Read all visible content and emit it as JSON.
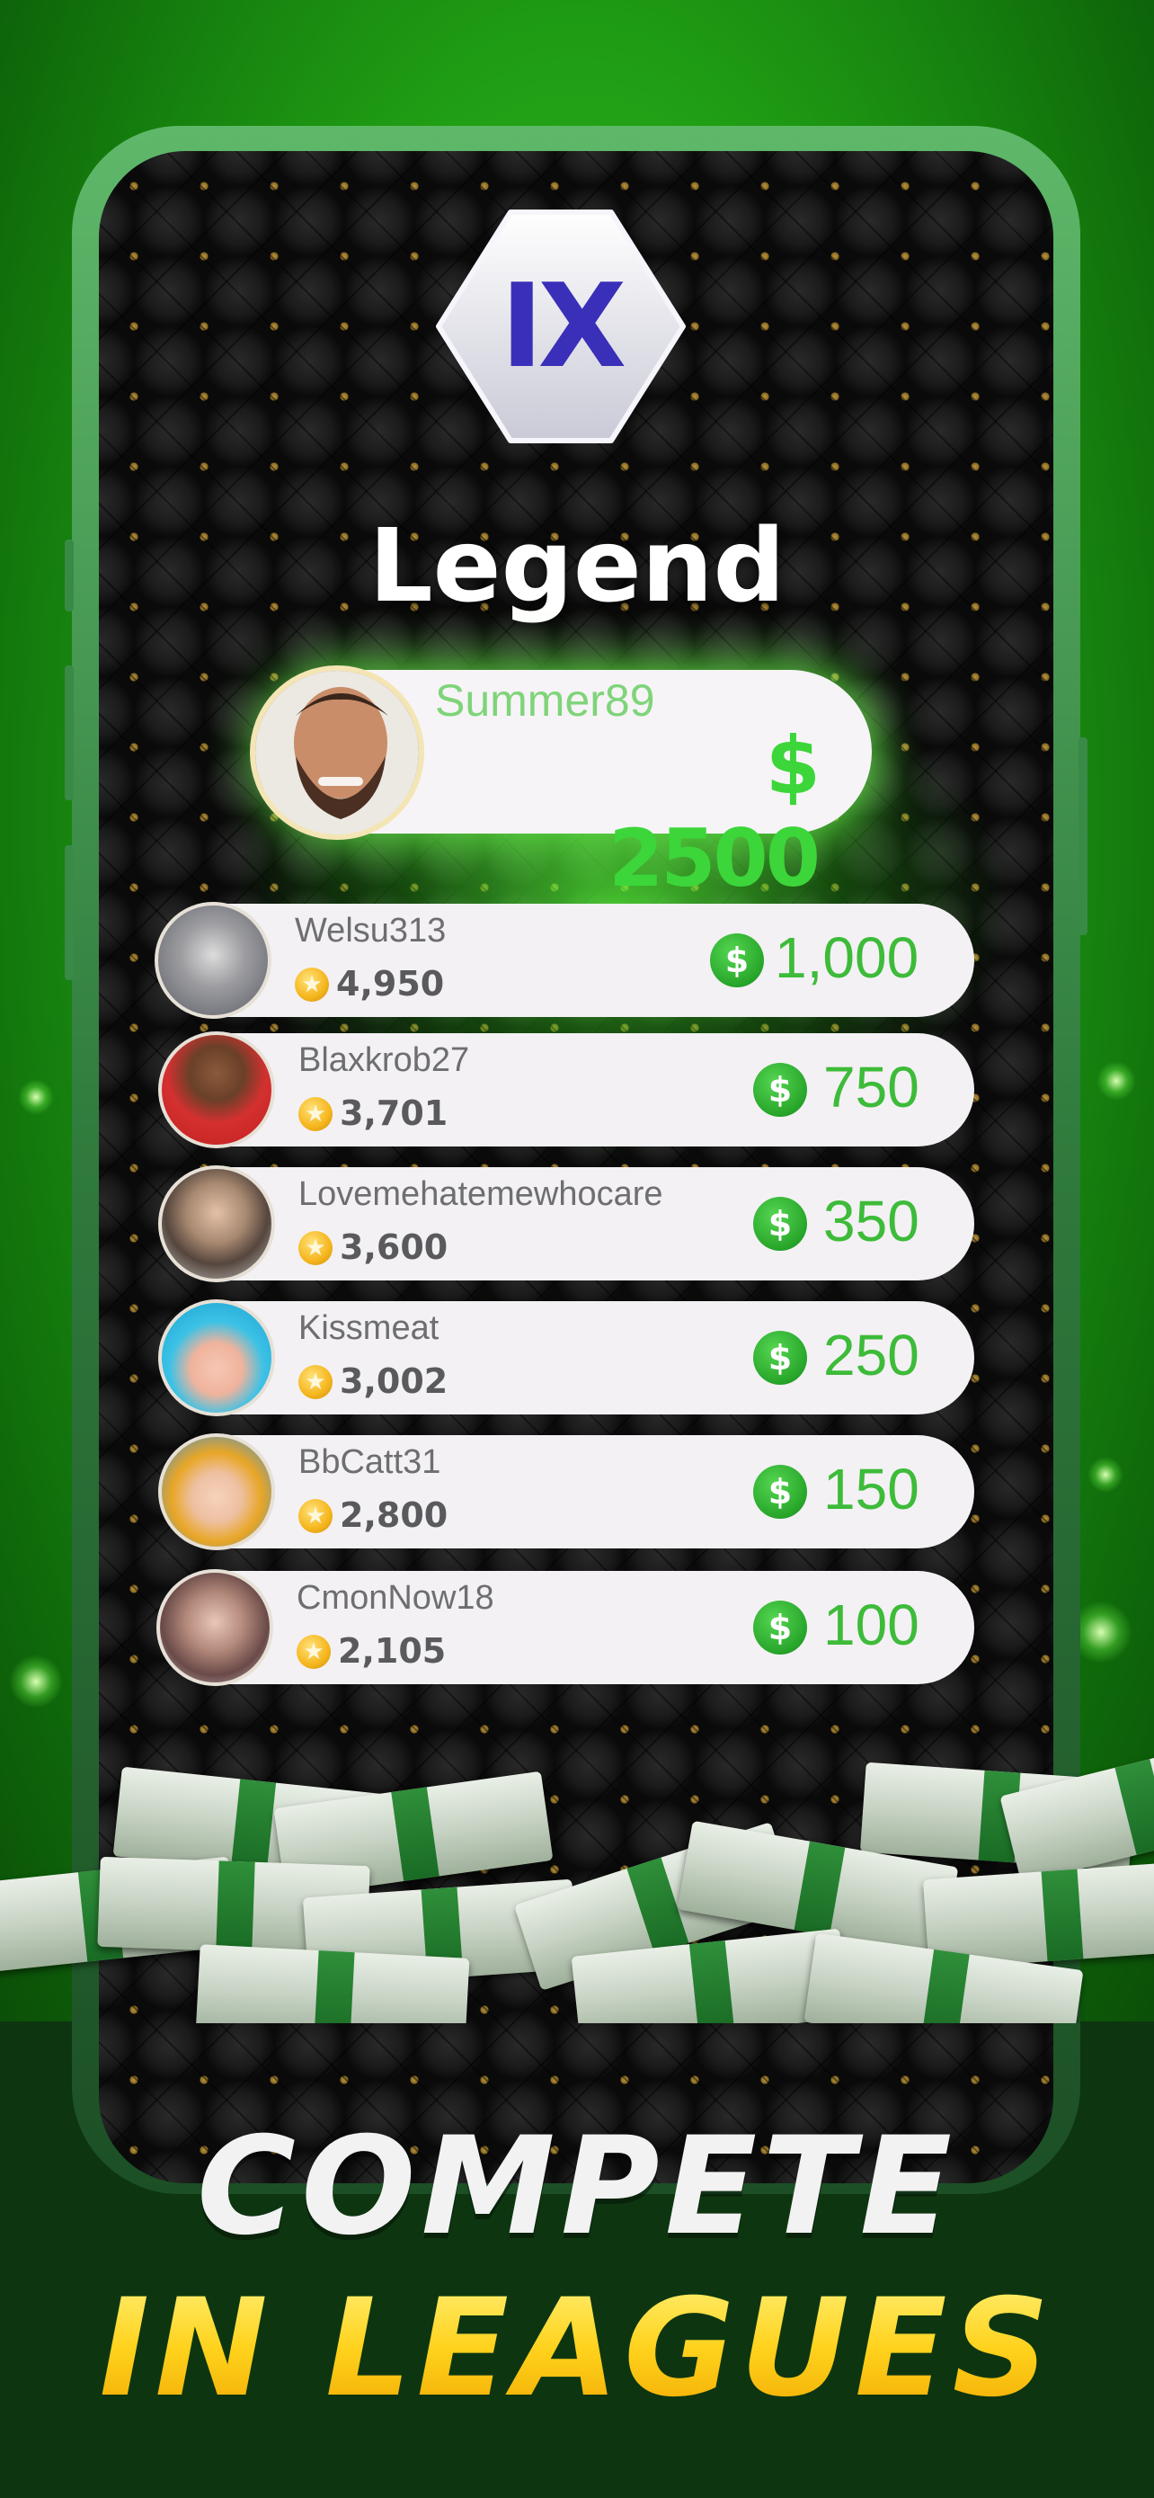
{
  "league": {
    "badge": "IX",
    "name": "Legend"
  },
  "top_player": {
    "name": "Summer89",
    "prize": "$ 2500"
  },
  "leaderboard": [
    {
      "name": "Welsu313",
      "score": "4,950",
      "prize": "1,000"
    },
    {
      "name": "Blaxkrob27",
      "score": "3,701",
      "prize": "750"
    },
    {
      "name": "Lovemehatemewhocare",
      "score": "3,600",
      "prize": "350"
    },
    {
      "name": "Kissmeat",
      "score": "3,002",
      "prize": "250"
    },
    {
      "name": "BbCatt31",
      "score": "2,800",
      "prize": "150"
    },
    {
      "name": "CmonNow18",
      "score": "2,105",
      "prize": "100"
    }
  ],
  "icons": {
    "coin": "$",
    "star": "★"
  },
  "headline": {
    "line1": "COMPETE",
    "line2": "IN LEAGUES"
  },
  "colors": {
    "accent_green": "#3dbb39",
    "headline_yellow": "#ffd21c"
  }
}
